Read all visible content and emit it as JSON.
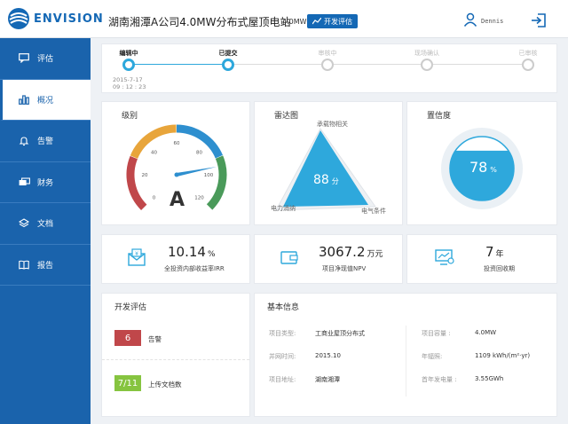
{
  "header": {
    "brand": "ENVISION",
    "title": "湖南湘潭A公司4.0MW分布式屋顶电站",
    "capacity": "4.0MW",
    "dev_eval_label": "开发评估",
    "username": "Dennis"
  },
  "sidebar": {
    "items": [
      {
        "label": "评估",
        "icon": "chat-icon"
      },
      {
        "label": "概况",
        "icon": "bar-chart-icon"
      },
      {
        "label": "告警",
        "icon": "bell-icon"
      },
      {
        "label": "财务",
        "icon": "money-icon"
      },
      {
        "label": "文档",
        "icon": "layers-icon"
      },
      {
        "label": "报告",
        "icon": "book-icon"
      }
    ],
    "active_index": 1
  },
  "progress": {
    "steps": [
      {
        "label": "编辑中",
        "done": true
      },
      {
        "label": "已提交",
        "done": true
      },
      {
        "label": "审核中",
        "done": false
      },
      {
        "label": "现场确认",
        "done": false
      },
      {
        "label": "已审核",
        "done": false
      }
    ],
    "date": "2015-7-17",
    "time": "09 : 12 : 23"
  },
  "rating": {
    "title": "级别",
    "grade": "A",
    "ticks": [
      "0",
      "20",
      "40",
      "60",
      "80",
      "100",
      "120"
    ],
    "value": 95,
    "max": 120
  },
  "radar": {
    "title": "雷达图",
    "axes": [
      "承载物相关",
      "电力消纳",
      "电气条件"
    ],
    "score": "88",
    "score_unit": "分"
  },
  "confidence": {
    "title": "置信度",
    "value": "78",
    "unit": "%"
  },
  "kpis": [
    {
      "value": "10.14",
      "unit": "%",
      "label": "全投资内部收益率IRR",
      "icon": "envelope-money-icon"
    },
    {
      "value": "3067.2",
      "unit": "万元",
      "label": "项目净现值NPV",
      "icon": "wallet-icon"
    },
    {
      "value": "7",
      "unit": "年",
      "label": "投资回收期",
      "icon": "monitor-chart-icon"
    }
  ],
  "dev_eval": {
    "title": "开发评估",
    "alarms_count": "6",
    "alarms_label": "告警",
    "docs_count": "7/11",
    "docs_label": "上传文档数",
    "colors": {
      "alarm": "#c0474a",
      "docs": "#86c440"
    }
  },
  "basic_info": {
    "title": "基本信息",
    "left": [
      {
        "k": "项目类型:",
        "v": "工商业屋顶分布式"
      },
      {
        "k": "并网时间:",
        "v": "2015.10"
      },
      {
        "k": "项目地址:",
        "v": "湖南湘潭"
      }
    ],
    "right": [
      {
        "k": "项目容量 :",
        "v": "4.0MW"
      },
      {
        "k": "年辐照:",
        "v": "1109 kWh/(m²·yr)"
      },
      {
        "k": "首年发电量 :",
        "v": "3.55GWh"
      }
    ]
  }
}
